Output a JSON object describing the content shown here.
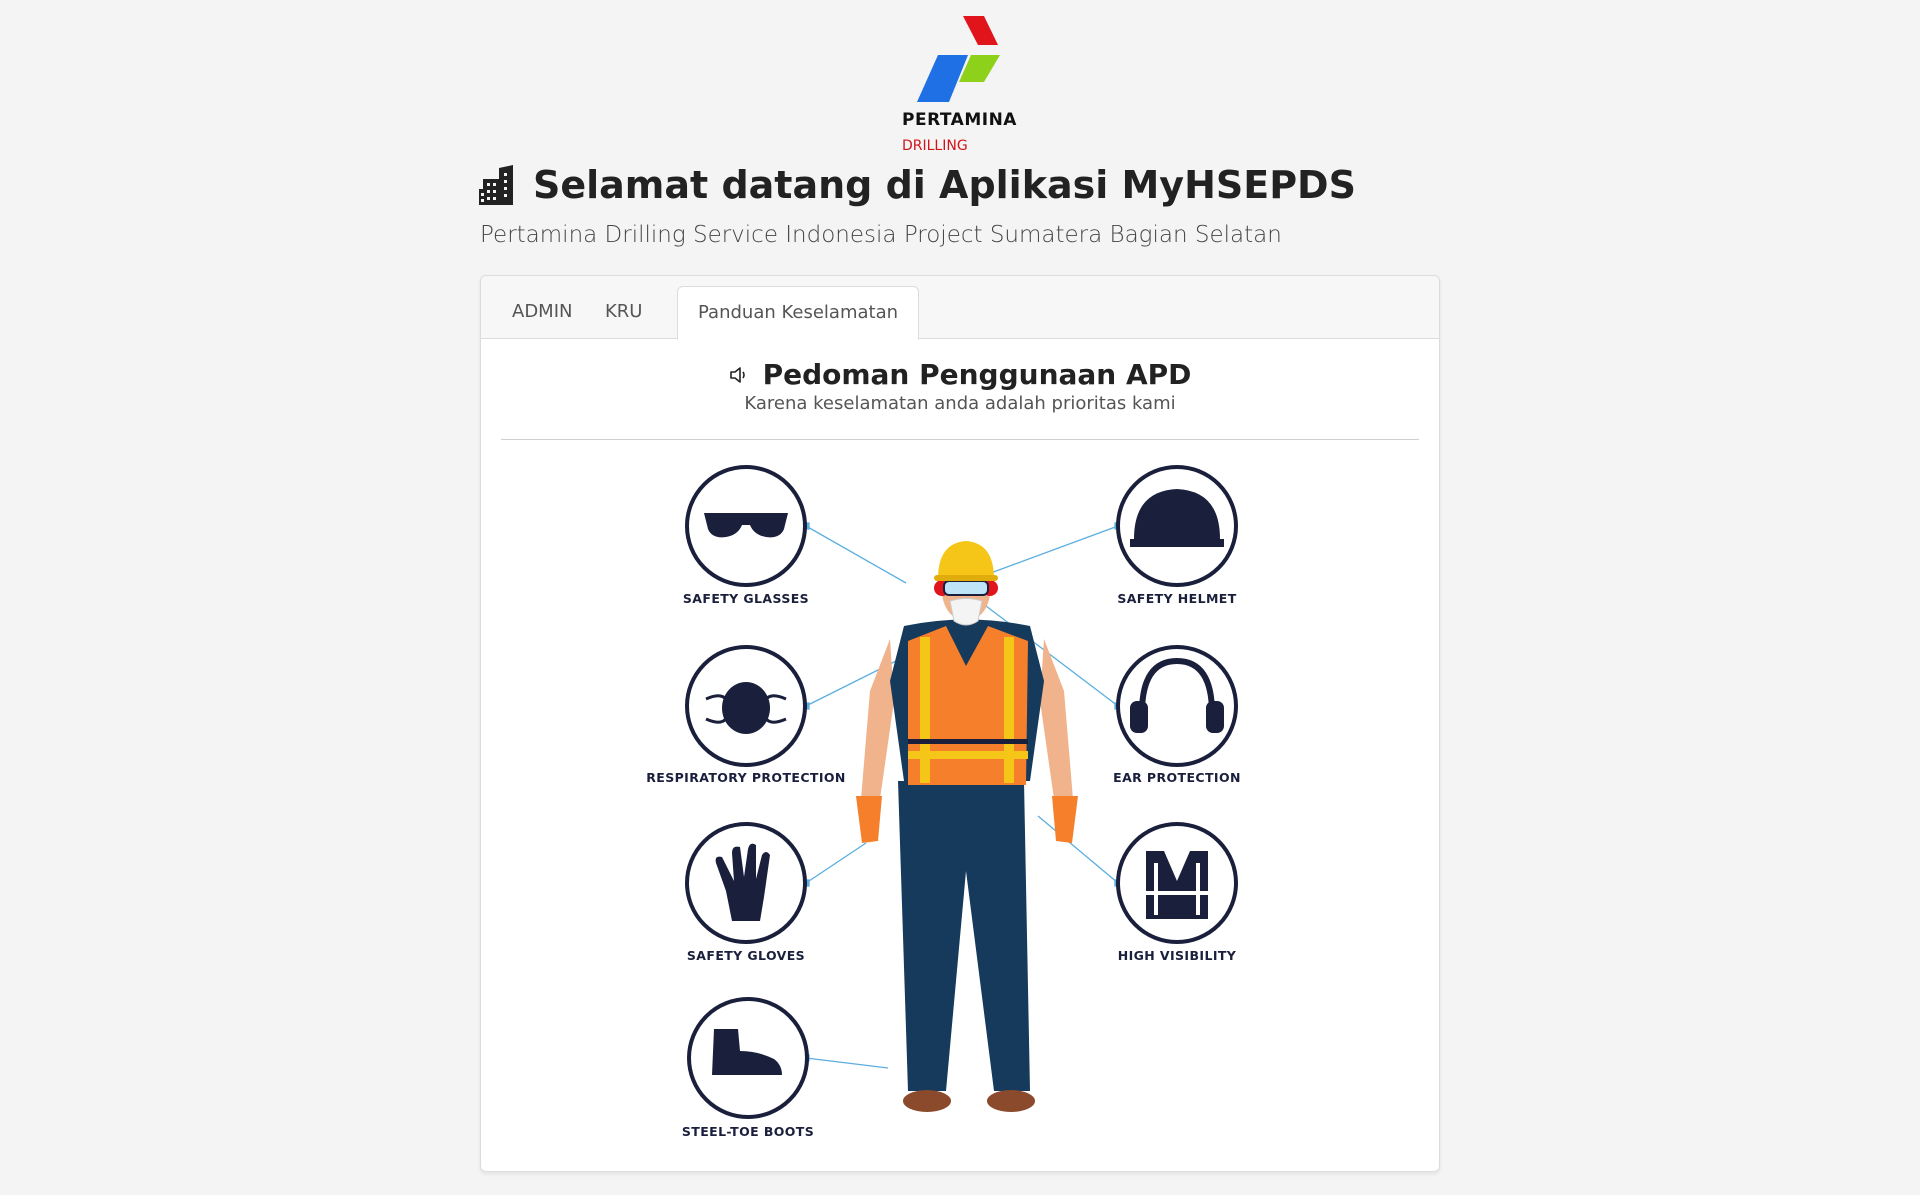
{
  "brand": {
    "name": "PERTAMINA",
    "division": "DRILLING"
  },
  "header": {
    "title": "Selamat datang di Aplikasi MyHSEPDS",
    "subtitle": "Pertamina Drilling Service Indonesia Project Sumatera Bagian Selatan",
    "icon": "building-icon"
  },
  "tabs": [
    {
      "label": "ADMIN",
      "active": false
    },
    {
      "label": "KRU",
      "active": false
    },
    {
      "label": "Panduan Keselamatan",
      "active": true
    }
  ],
  "section": {
    "title": "Pedoman Penggunaan APD",
    "subtitle": "Karena keselamatan anda adalah prioritas kami",
    "icon": "speaker-icon"
  },
  "ppe": {
    "left": [
      "SAFETY GLASSES",
      "RESPIRATORY PROTECTION",
      "SAFETY GLOVES",
      "STEEL-TOE BOOTS"
    ],
    "right": [
      "SAFETY HELMET",
      "EAR PROTECTION",
      "HIGH VISIBILITY"
    ]
  },
  "colors": {
    "navy": "#1a1f3c",
    "vest": "#f57f2a",
    "helmet": "#f5c518",
    "connector": "#5aaee0",
    "logo_red": "#e1141c",
    "logo_green": "#8ed11b",
    "logo_blue": "#1f6fe5"
  }
}
